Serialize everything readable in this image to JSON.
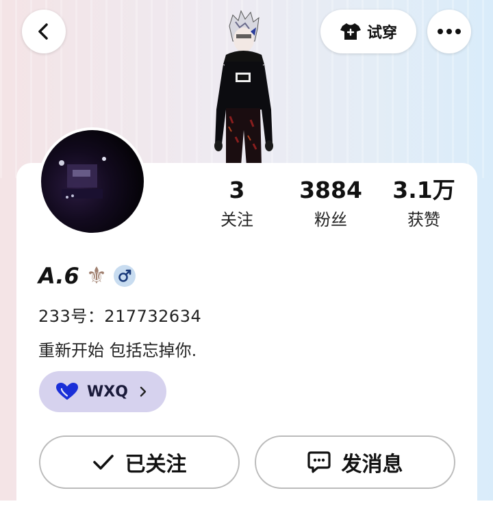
{
  "header": {
    "back_icon": "chevron-left-icon",
    "try_on_label": "试穿",
    "try_on_icon": "tshirt-icon",
    "more_icon": "more-dots-icon"
  },
  "stats": [
    {
      "value": "3",
      "label": "关注"
    },
    {
      "value": "3884",
      "label": "粉丝"
    },
    {
      "value": "3.1万",
      "label": "获赞"
    }
  ],
  "profile": {
    "name": "A.6",
    "name_ornament": "⚜",
    "gender_icon": "male-icon",
    "uid": "233号：217732634",
    "bio": "重新开始 包括忘掉你."
  },
  "tag": {
    "label": "WXQ",
    "icon": "heart-icon",
    "color": "#1a2fd8"
  },
  "actions": {
    "follow_label": "已关注",
    "message_label": "发消息"
  },
  "colors": {
    "tag_bg": "#d6d2ee",
    "gender_bg": "#c8dcf0"
  }
}
